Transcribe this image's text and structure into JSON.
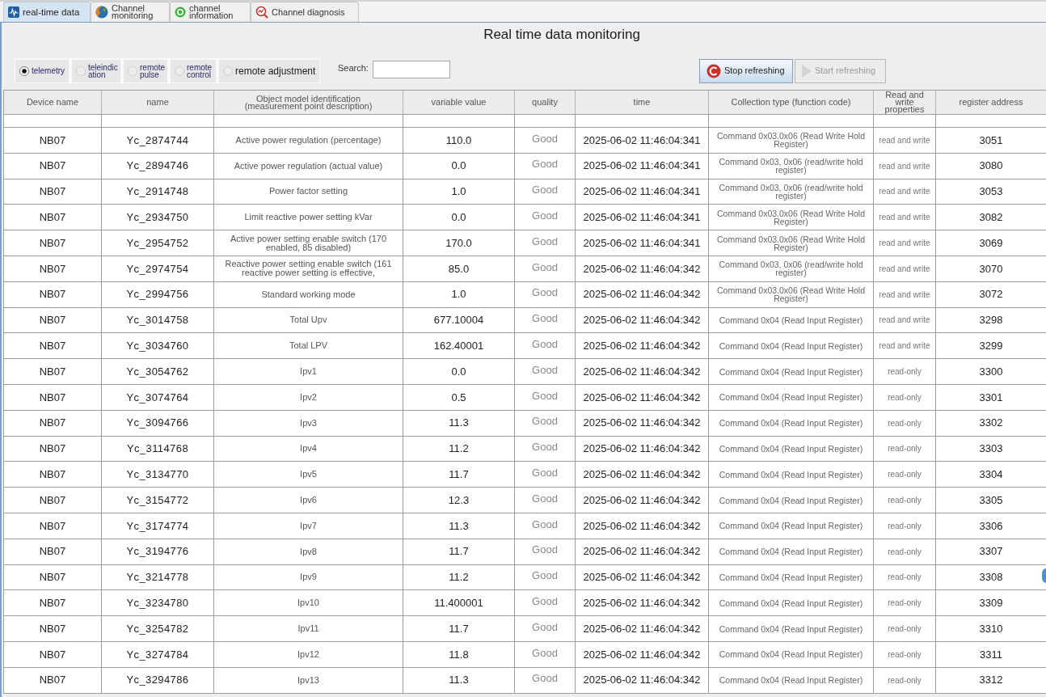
{
  "tabs": [
    {
      "label": "real-time data",
      "selected": true
    },
    {
      "label": "Channel monitoring",
      "selected": false
    },
    {
      "label": "channel information",
      "selected": false
    },
    {
      "label": "Channel diagnosis",
      "selected": false
    }
  ],
  "title": "Real time data monitoring",
  "point_types": [
    {
      "label": "telemetry",
      "selected": true
    },
    {
      "label": "teleindication",
      "selected": false
    },
    {
      "label": "remote pulse",
      "selected": false
    },
    {
      "label": "remote control",
      "selected": false
    },
    {
      "label": "remote adjustment",
      "selected": false
    }
  ],
  "search": {
    "label": "Search:"
  },
  "buttons": [
    {
      "label": "Stop refreshing",
      "disabled": false
    },
    {
      "label": "Start refreshing",
      "disabled": true
    }
  ],
  "table": {
    "columns": [
      "Device name",
      "name",
      "Object model identification (measurement point description)",
      "variable value",
      "quality",
      "time",
      "Collection type (function code)",
      "Read and write properties",
      "register address"
    ],
    "rows": [
      {
        "cells": [
          "NB07",
          "Yc_2874744",
          "Active power regulation (percentage)",
          "110.0",
          "Good",
          "2025-06-02 11:46:04:341",
          "Command 0x03.0x06 (Read Write Hold Register)",
          "read and write",
          "3051"
        ]
      },
      {
        "cells": [
          "NB07",
          "Yc_2894746",
          "Active power regulation (actual value)",
          "0.0",
          "Good",
          "2025-06-02 11:46:04:341",
          "Command 0x03, 0x06 (read/write hold register)",
          "read and write",
          "3080"
        ]
      },
      {
        "cells": [
          "NB07",
          "Yc_2914748",
          "Power factor setting",
          "1.0",
          "Good",
          "2025-06-02 11:46:04:341",
          "Command 0x03, 0x06 (read/write hold register)",
          "read and write",
          "3053"
        ]
      },
      {
        "cells": [
          "NB07",
          "Yc_2934750",
          "Limit reactive power setting kVar",
          "0.0",
          "Good",
          "2025-06-02 11:46:04:341",
          "Command 0x03.0x06 (Read Write Hold Register)",
          "read and write",
          "3082"
        ]
      },
      {
        "cells": [
          "NB07",
          "Yc_2954752",
          "Active power setting enable switch (170 enabled, 85 disabled)",
          "170.0",
          "Good",
          "2025-06-02 11:46:04:341",
          "Command 0x03.0x06 (Read Write Hold Register)",
          "read and write",
          "3069"
        ]
      },
      {
        "cells": [
          "NB07",
          "Yc_2974754",
          "Reactive power setting enable switch (161 reactive power setting is effective,",
          "85.0",
          "Good",
          "2025-06-02 11:46:04:342",
          "Command 0x03, 0x06 (read/write hold register)",
          "read and write",
          "3070"
        ]
      },
      {
        "cells": [
          "NB07",
          "Yc_2994756",
          "Standard working mode",
          "1.0",
          "Good",
          "2025-06-02 11:46:04:342",
          "Command 0x03.0x06 (Read Write Hold Register)",
          "read and write",
          "3072"
        ]
      },
      {
        "cells": [
          "NB07",
          "Yc_3014758",
          "Total Upv",
          "677.10004",
          "Good",
          "2025-06-02 11:46:04:342",
          "Command 0x04 (Read Input Register)",
          "read and write",
          "3298"
        ]
      },
      {
        "cells": [
          "NB07",
          "Yc_3034760",
          "Total LPV",
          "162.40001",
          "Good",
          "2025-06-02 11:46:04:342",
          "Command 0x04 (Read Input Register)",
          "read and write",
          "3299"
        ]
      },
      {
        "cells": [
          "NB07",
          "Yc_3054762",
          "Ipv1",
          "0.0",
          "Good",
          "2025-06-02 11:46:04:342",
          "Command 0x04 (Read Input Register)",
          "read-only",
          "3300"
        ]
      },
      {
        "cells": [
          "NB07",
          "Yc_3074764",
          "Ipv2",
          "0.5",
          "Good",
          "2025-06-02 11:46:04:342",
          "Command 0x04 (Read Input Register)",
          "read-only",
          "3301"
        ]
      },
      {
        "cells": [
          "NB07",
          "Yc_3094766",
          "Ipv3",
          "11.3",
          "Good",
          "2025-06-02 11:46:04:342",
          "Command 0x04 (Read Input Register)",
          "read-only",
          "3302"
        ]
      },
      {
        "cells": [
          "NB07",
          "Yc_3114768",
          "Ipv4",
          "11.2",
          "Good",
          "2025-06-02 11:46:04:342",
          "Command 0x04 (Read Input Register)",
          "read-only",
          "3303"
        ]
      },
      {
        "cells": [
          "NB07",
          "Yc_3134770",
          "Ipv5",
          "11.7",
          "Good",
          "2025-06-02 11:46:04:342",
          "Command 0x04 (Read Input Register)",
          "read-only",
          "3304"
        ]
      },
      {
        "cells": [
          "NB07",
          "Yc_3154772",
          "Ipv6",
          "12.3",
          "Good",
          "2025-06-02 11:46:04:342",
          "Command 0x04 (Read Input Register)",
          "read-only",
          "3305"
        ]
      },
      {
        "cells": [
          "NB07",
          "Yc_3174774",
          "Ipv7",
          "11.3",
          "Good",
          "2025-06-02 11:46:04:342",
          "Command 0x04 (Read Input Register)",
          "read-only",
          "3306"
        ]
      },
      {
        "cells": [
          "NB07",
          "Yc_3194776",
          "Ipv8",
          "11.7",
          "Good",
          "2025-06-02 11:46:04:342",
          "Command 0x04 (Read Input Register)",
          "read-only",
          "3307"
        ]
      },
      {
        "cells": [
          "NB07",
          "Yc_3214778",
          "Ipv9",
          "11.2",
          "Good",
          "2025-06-02 11:46:04:342",
          "Command 0x04 (Read Input Register)",
          "read-only",
          "3308"
        ]
      },
      {
        "cells": [
          "NB07",
          "Yc_3234780",
          "Ipv10",
          "11.400001",
          "Good",
          "2025-06-02 11:46:04:342",
          "Command 0x04 (Read Input Register)",
          "read-only",
          "3309"
        ]
      },
      {
        "cells": [
          "NB07",
          "Yc_3254782",
          "Ipv11",
          "11.7",
          "Good",
          "2025-06-02 11:46:04:342",
          "Command 0x04 (Read Input Register)",
          "read-only",
          "3310"
        ]
      },
      {
        "cells": [
          "NB07",
          "Yc_3274784",
          "Ipv12",
          "11.8",
          "Good",
          "2025-06-02 11:46:04:342",
          "Command 0x04 (Read Input Register)",
          "read-only",
          "3311"
        ]
      },
      {
        "cells": [
          "NB07",
          "Yc_3294786",
          "Ipv13",
          "11.3",
          "Good",
          "2025-06-02 11:46:04:342",
          "Command 0x04 (Read Input Register)",
          "read-only",
          "3312"
        ]
      }
    ]
  }
}
